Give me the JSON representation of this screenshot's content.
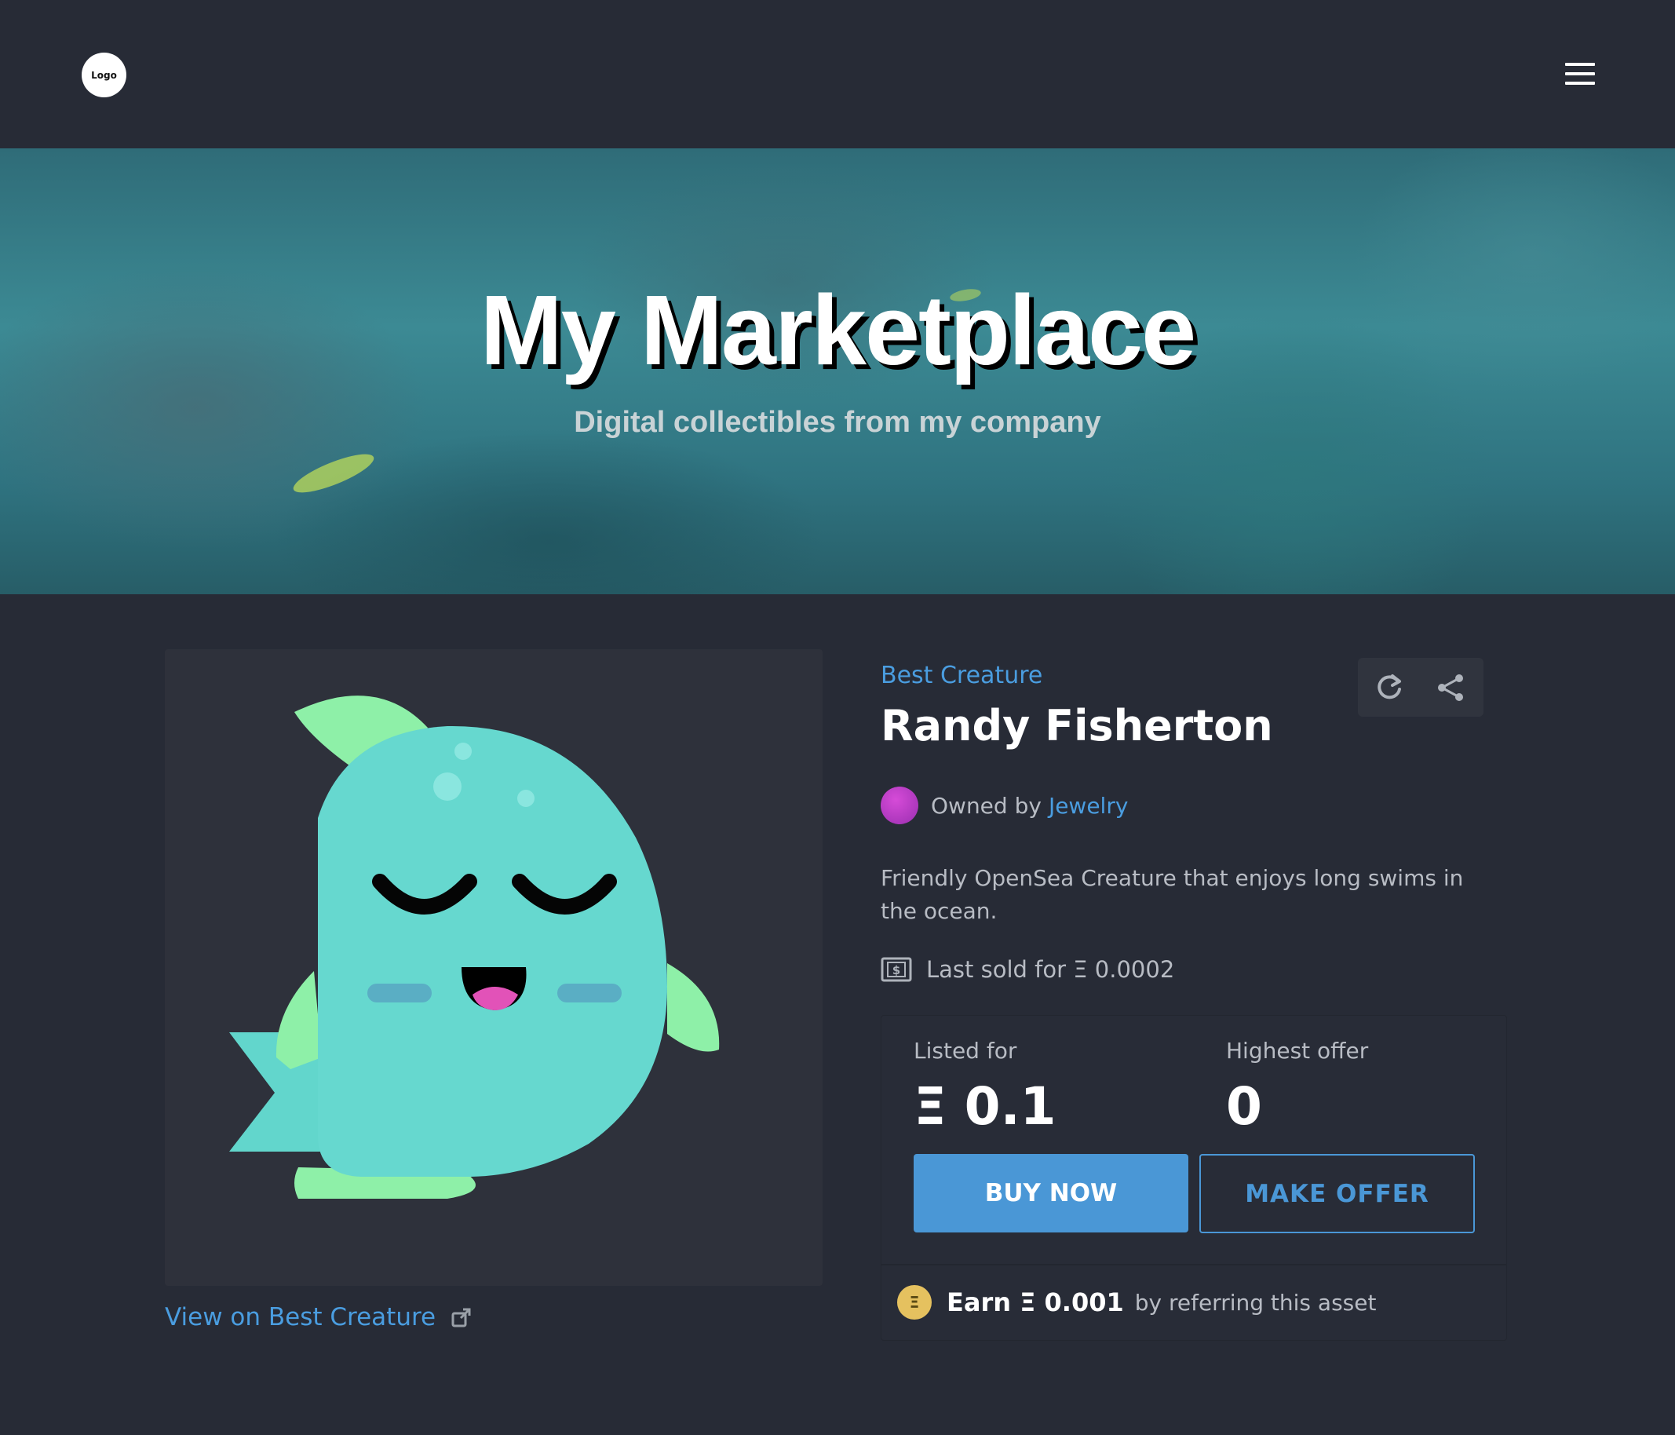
{
  "header": {
    "logo_text": "Logo",
    "menu_icon": "hamburger-menu-icon"
  },
  "hero": {
    "title": "My Marketplace",
    "subtitle": "Digital collectibles from my company"
  },
  "asset": {
    "collection": "Best Creature",
    "name": "Randy Fisherton",
    "owned_by_label": "Owned by",
    "owner": "Jewelry",
    "description": "Friendly OpenSea Creature that enjoys long swims in the ocean.",
    "last_sold": "Last sold for Ξ 0.0002",
    "view_link": "View on Best Creature"
  },
  "pricing": {
    "listed_label": "Listed for",
    "listed_value": "Ξ 0.1",
    "offer_label": "Highest offer",
    "offer_value": "0",
    "buy_label": "BUY NOW",
    "make_offer_label": "MAKE OFFER",
    "earn_coin": "Ξ",
    "earn_amount": "Earn Ξ 0.001",
    "earn_suffix": "by referring this asset"
  },
  "colors": {
    "accent": "#4a9de0",
    "background": "#272b36",
    "button": "#4a97d6",
    "coin": "#e5c15f"
  },
  "icons": [
    "refresh-icon",
    "share-icon",
    "external-link-icon",
    "money-icon"
  ]
}
